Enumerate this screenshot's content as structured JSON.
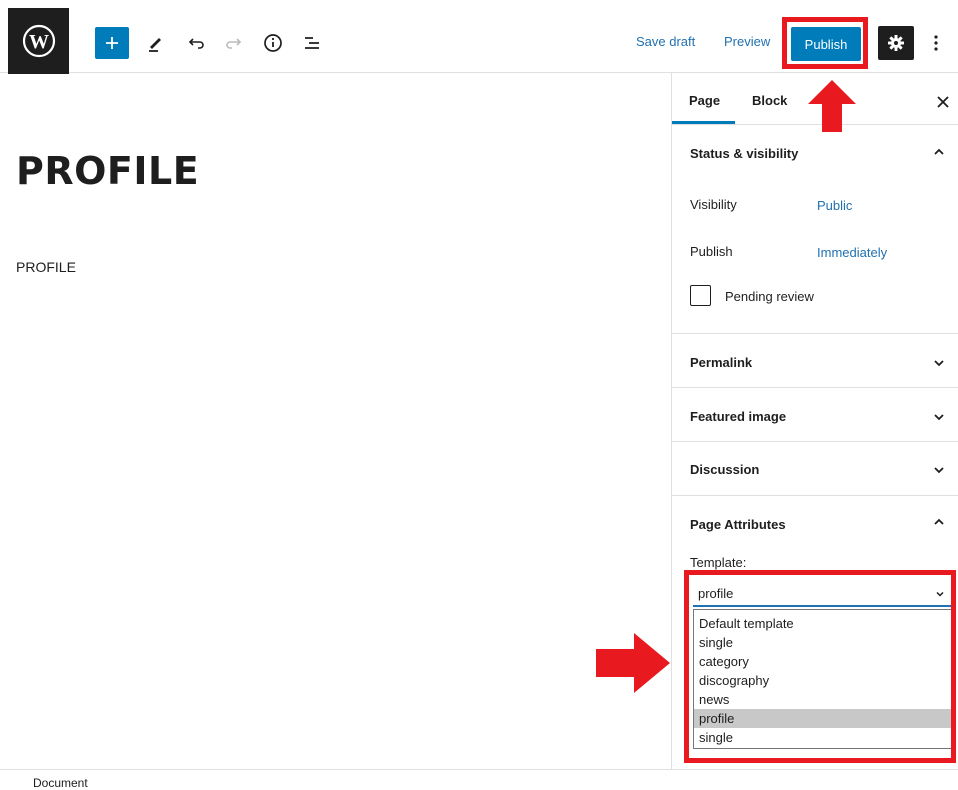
{
  "toolbar": {
    "save_draft_label": "Save draft",
    "preview_label": "Preview",
    "publish_label": "Publish",
    "icons": [
      "wordpress-icon",
      "plus-icon",
      "pencil-icon",
      "undo-icon",
      "redo-icon",
      "info-icon",
      "list-view-icon",
      "gear-icon",
      "more-vertical-icon"
    ]
  },
  "editor": {
    "title": "PROFILE",
    "paragraph": "PROFILE"
  },
  "sidebar": {
    "tabs": [
      {
        "label": "Page",
        "active": true
      },
      {
        "label": "Block",
        "active": false
      }
    ],
    "close_icon": "close-icon",
    "status_visibility": {
      "title": "Status & visibility",
      "expanded": true,
      "visibility_label": "Visibility",
      "visibility_value": "Public",
      "publish_label": "Publish",
      "publish_value": "Immediately",
      "pending_review_label": "Pending review",
      "pending_review_checked": false
    },
    "panels": [
      {
        "title": "Permalink",
        "expanded": false
      },
      {
        "title": "Featured image",
        "expanded": false
      },
      {
        "title": "Discussion",
        "expanded": false
      }
    ],
    "page_attributes": {
      "title": "Page Attributes",
      "expanded": true,
      "template_label": "Template:",
      "template_value": "profile",
      "options": [
        "Default template",
        "single",
        "category",
        "discography",
        "news",
        "profile",
        "single"
      ],
      "selected_index": 5
    }
  },
  "footer": {
    "breadcrumb": "Document"
  },
  "colors": {
    "accent": "#007cba",
    "link": "#2271b1",
    "highlight": "#e8191f",
    "dark": "#1e1e1e"
  }
}
